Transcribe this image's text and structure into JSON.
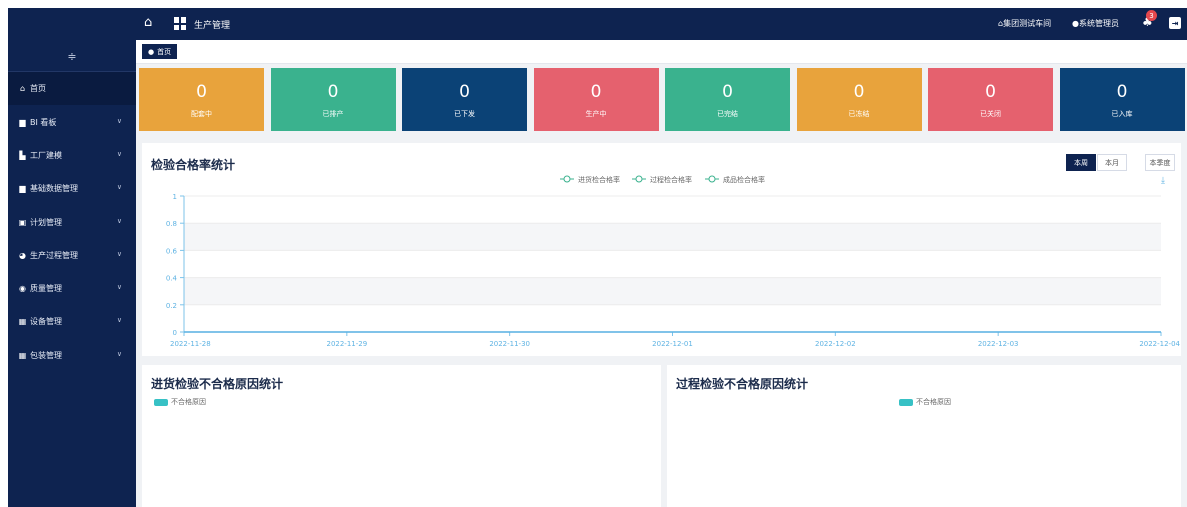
{
  "topbar": {
    "title": "生产管理",
    "workshop": "集团测试车间",
    "user": "系统管理员",
    "notification_count": "3"
  },
  "tabs": [
    {
      "label": "首页"
    }
  ],
  "sidebar": {
    "items": [
      {
        "label": "首页",
        "icon": "home-icon",
        "glyph": "⌂",
        "has_children": false
      },
      {
        "label": "BI 看板",
        "icon": "folder-icon",
        "glyph": "▆",
        "has_children": true
      },
      {
        "label": "工厂建模",
        "icon": "factory-icon",
        "glyph": "▙",
        "has_children": true
      },
      {
        "label": "基础数据管理",
        "icon": "folder-icon",
        "glyph": "▆",
        "has_children": true
      },
      {
        "label": "计划管理",
        "icon": "calendar-icon",
        "glyph": "▣",
        "has_children": true
      },
      {
        "label": "生产过程管理",
        "icon": "pie-icon",
        "glyph": "◕",
        "has_children": true
      },
      {
        "label": "质量管理",
        "icon": "shield-icon",
        "glyph": "◉",
        "has_children": true
      },
      {
        "label": "设备管理",
        "icon": "grid-icon",
        "glyph": "▦",
        "has_children": true
      },
      {
        "label": "包装管理",
        "icon": "box-icon",
        "glyph": "▦",
        "has_children": true
      }
    ]
  },
  "stats": [
    {
      "value": "0",
      "label": "配套中",
      "color": "#e8a33c"
    },
    {
      "value": "0",
      "label": "已排产",
      "color": "#3ab28e"
    },
    {
      "value": "0",
      "label": "已下发",
      "color": "#0b4276"
    },
    {
      "value": "0",
      "label": "生产中",
      "color": "#e5616e"
    },
    {
      "value": "0",
      "label": "已完结",
      "color": "#3ab28e"
    },
    {
      "value": "0",
      "label": "已冻结",
      "color": "#e8a33c"
    },
    {
      "value": "0",
      "label": "已关闭",
      "color": "#e5616e"
    },
    {
      "value": "0",
      "label": "已入库",
      "color": "#0b4276"
    }
  ],
  "quality_panel": {
    "title": "检验合格率统计",
    "periods": [
      {
        "label": "本周",
        "active": true
      },
      {
        "label": "本月",
        "active": false
      },
      {
        "label": "本季度",
        "active": false
      }
    ]
  },
  "chart_data": {
    "type": "line",
    "title": "检验合格率统计",
    "x": [
      "2022-11-28",
      "2022-11-29",
      "2022-11-30",
      "2022-12-01",
      "2022-12-02",
      "2022-12-03",
      "2022-12-04"
    ],
    "series": [
      {
        "name": "进货检合格率",
        "values": [
          0,
          0,
          0,
          0,
          0,
          0,
          0
        ]
      },
      {
        "name": "过程检合格率",
        "values": [
          0,
          0,
          0,
          0,
          0,
          0,
          0
        ]
      },
      {
        "name": "成品检合格率",
        "values": [
          0,
          0,
          0,
          0,
          0,
          0,
          0
        ]
      }
    ],
    "ylim": [
      0,
      1
    ],
    "yticks": [
      "0",
      "0.2",
      "0.4",
      "0.6",
      "0.8",
      "1"
    ],
    "legend_position": "top-center",
    "grid": true,
    "line_color": "#5fb3e3"
  },
  "incoming_panel": {
    "title": "进货检验不合格原因统计",
    "legend": "不合格原因"
  },
  "process_panel": {
    "title": "过程检验不合格原因统计",
    "legend": "不合格原因"
  }
}
